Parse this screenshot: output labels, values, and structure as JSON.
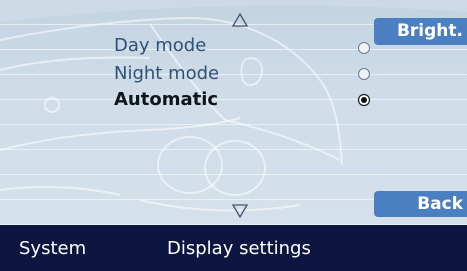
{
  "menu": {
    "options": [
      {
        "label": "Day mode",
        "selected": false
      },
      {
        "label": "Night mode",
        "selected": false
      },
      {
        "label": "Automatic",
        "selected": true
      }
    ],
    "scroll_up_icon": "triangle-up-outline",
    "scroll_down_icon": "triangle-down-outline"
  },
  "softkeys": {
    "top": "Bright.",
    "bottom": "Back"
  },
  "statusbar": {
    "app": "System",
    "menu": "Display settings"
  },
  "colors": {
    "background": "#d3dfe9",
    "softkey": "#4a7fc2",
    "statusbar": "#0d1640",
    "option_text": "#2f5077",
    "option_active_text": "#10151d"
  }
}
